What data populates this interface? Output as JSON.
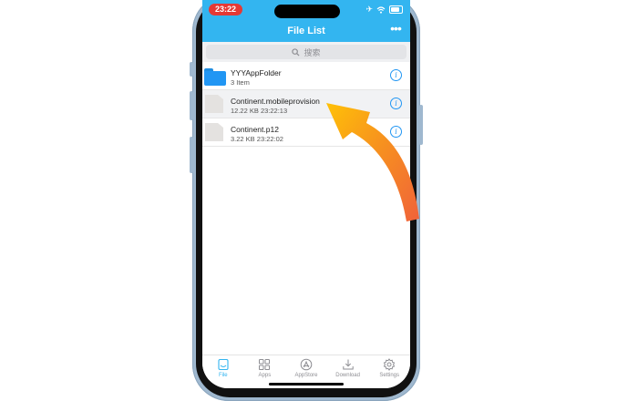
{
  "status": {
    "time": "23:22"
  },
  "navbar": {
    "title": "File List",
    "more_label": "•••"
  },
  "search": {
    "placeholder": "搜索"
  },
  "files": [
    {
      "name": "YYYAppFolder",
      "meta": "3 Item",
      "type": "folder"
    },
    {
      "name": "Continent.mobileprovision",
      "meta": "12.22 KB   23:22:13",
      "type": "file"
    },
    {
      "name": "Continent.p12",
      "meta": "3.22 KB   23:22:02",
      "type": "file"
    }
  ],
  "tabs": [
    {
      "label": "File",
      "icon": "file-icon",
      "active": true
    },
    {
      "label": "Apps",
      "icon": "apps-grid-icon",
      "active": false
    },
    {
      "label": "AppStore",
      "icon": "appstore-icon",
      "active": false
    },
    {
      "label": "Download",
      "icon": "download-icon",
      "active": false
    },
    {
      "label": "Settings",
      "icon": "gear-icon",
      "active": false
    }
  ],
  "colors": {
    "accent": "#33b5f0",
    "info": "#2196f3",
    "arrow_start": "#f0623a",
    "arrow_end": "#ffc107"
  }
}
